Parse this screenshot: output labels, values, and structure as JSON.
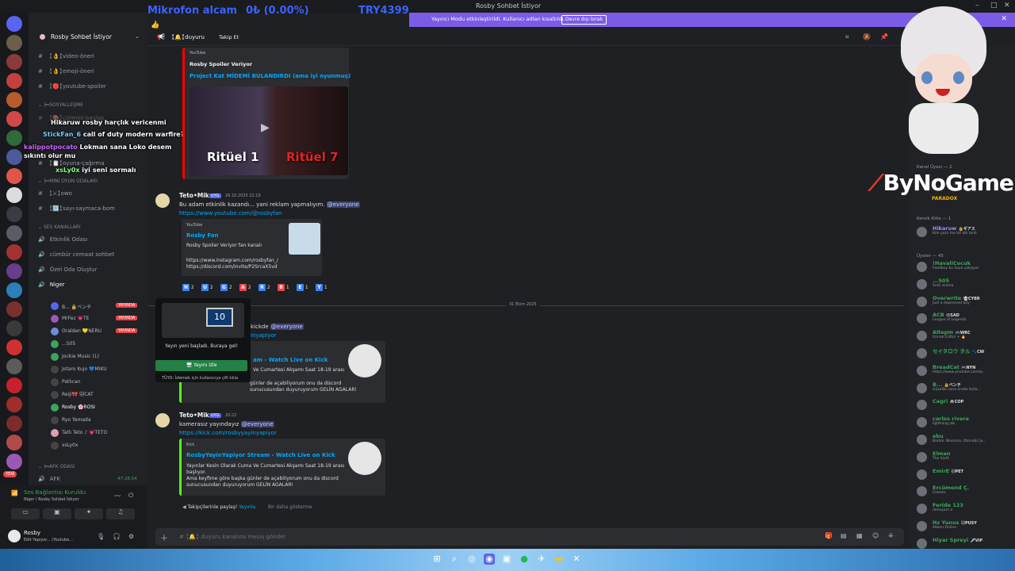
{
  "window": {
    "title": "Rosby Sohbet İstiyor",
    "min": "–",
    "max": "□",
    "close": "✕"
  },
  "banner": {
    "text": "Yayıncı Modu etkinleştirildi. Kullanıcı adları kısaltıldı.",
    "button": "Devre dışı bırak",
    "close": "✕"
  },
  "ticker": {
    "mic": "Mikrofon alcam",
    "amount": "0₺ (0.00%)",
    "goal": "TRY4399",
    "emoji": "👍"
  },
  "sidebar": {
    "server_name": "Rosby Sohbet İstiyor",
    "channels": [
      {
        "name": "╏👌╏video-öneri"
      },
      {
        "name": "╏👌╏emoji-öneri"
      },
      {
        "name": "╏🔴╏youtube-spoiler"
      },
      {
        "name": "SOSYALLEŞME",
        "category": true
      },
      {
        "name": "╏🎨╏çizimini-paylaş"
      },
      {
        "name": "╏📋╏oyuna-çağırma"
      },
      {
        "name": "MİNİ OYUN ODALARI",
        "category": true
      },
      {
        "name": "╏⚔╏owo"
      },
      {
        "name": "╏🔢╏sayı-saymaca-bom"
      },
      {
        "name": "SES KANALLARI",
        "category": true
      },
      {
        "name": "Etkinlik Odası"
      },
      {
        "name": "cümbür cemaat sohbet"
      },
      {
        "name": "Özel Oda Oluştur"
      },
      {
        "name": "Niger"
      }
    ],
    "voice_users": [
      {
        "name": "B... 🔒ベンチ",
        "live": true
      },
      {
        "name": "MrFez 💗TE",
        "live": true
      },
      {
        "name": "Oralden 💛NERU",
        "live": true
      },
      {
        "name": "...505",
        "live": false
      },
      {
        "name": "Jockie Music (1)",
        "live": false
      },
      {
        "name": "Jotaro Kujo 💙MIKU",
        "live": false
      },
      {
        "name": "Patlıcan",
        "live": false
      },
      {
        "name": "Reiji🎀 🐱CAT",
        "live": false
      },
      {
        "name": "Rosby 🌸ROSI",
        "live": false
      },
      {
        "name": "Ryo Yamada",
        "live": false
      },
      {
        "name": "Tatlı Teto ♪ 💗TETO",
        "live": false
      },
      {
        "name": "xsLy0x",
        "live": false
      }
    ],
    "live_label": "YAYINDA",
    "afk_category": "AFK ODASI",
    "afk_channel": "AFK",
    "afk_time": "47:28:54",
    "yeni": "YENİ"
  },
  "chat_overlay": [
    {
      "user": "Hikaruw",
      "text": "rosby harçlık vericenmi"
    },
    {
      "user": "StickFan_6",
      "text": "call of duty modern warfire?"
    },
    {
      "user": "kalippotpocato",
      "text": "Lokman sana Loko desem sıkıntı olur mu"
    },
    {
      "user": "xsLy0x",
      "text": "iyi seni sormalı"
    }
  ],
  "voice_panel": {
    "status": "Ses Bağlantısı Kuruldu",
    "channel": "Niger / Rosby Sohbet İstiyor"
  },
  "user_panel": {
    "name": "Rosby",
    "status": "Edit Yapıyor... (Youtube..."
  },
  "channel_header": {
    "name": "╏🔔╏duyuru",
    "follow": "Takip Et"
  },
  "messages": [
    {
      "embed_provider": "YouTube",
      "embed_author": "Rosby Spoiler Veriyor",
      "embed_title": "Project Kat MİDEMİ BULANDIRDI (ama iyi oyunmuş)",
      "thumb_left": "Ritüel 1",
      "thumb_right": "Ritüel 7"
    },
    {
      "author": "Teto•Miku",
      "badge": "UYG",
      "time": "29.10.2025 22:19",
      "text": "Bu adam etkinlik kazandı... yani reklam yapmalıyım.",
      "mention": "@everyone",
      "link": "https://www.youtube.com/@rosbyfan",
      "embed_provider": "YouTube",
      "embed_title": "Rosby Fan",
      "embed_desc": "Rosby Spoiler Veriyor fan kanalı",
      "embed_links": [
        "https://www.instagram.com/rosbyfan_/",
        "https://discord.com/invite/P2SrcaX5vd"
      ],
      "reactions": [
        {
          "emoji": "N",
          "count": "2",
          "color": "#3b82f6"
        },
        {
          "emoji": "U",
          "count": "2",
          "color": "#3b82f6"
        },
        {
          "emoji": "G",
          "count": "2",
          "color": "#3b82f6"
        },
        {
          "emoji": "A",
          "count": "2",
          "color": "#ef4444"
        },
        {
          "emoji": "R",
          "count": "2",
          "color": "#3b82f6"
        },
        {
          "emoji": "B",
          "count": "1",
          "color": "#ef4444"
        },
        {
          "emoji": "E",
          "count": "1",
          "color": "#3b82f6"
        },
        {
          "emoji": "Y",
          "count": "1",
          "color": "#3b82f6"
        }
      ]
    },
    {
      "date_divider": "31 Ekim 2025",
      "text": "kickde",
      "mention": "@everyone",
      "link": "inyapiyor",
      "embed_title": "am - Watch Live on Kick",
      "embed_desc": [
        "Ve Cumartesi Akşamı Saat 18-19 arası",
        "günler de açabiliyorum onu da discord",
        "sunucusundan duyuruyorum GELİN AGALAR!"
      ]
    },
    {
      "author": "Teto•Miku",
      "badge": "UYG",
      "time": "20:22",
      "text": "kamerasız yayındayız",
      "mention": "@everyone",
      "link": "https://kick.com/rosbyyayinyapiyor",
      "embed_provider": "Kick",
      "embed_title": "RosbyYayinYapiyor Stream - Watch Live on Kick",
      "embed_desc": [
        "Yayınlar Kesin Olarak Cuma Ve Cumartesi Akşamı Saat 18-19 arası",
        "başlıyor.",
        "Ama keyfime göre başka günler de açabiliyorum onu da discord",
        "sunucusundan duyuruyorum GELİN AGALAR!"
      ],
      "share_prefix": "Takipçilerinle paylaş!",
      "share_link": "Yayınla",
      "dismiss": "Bir daha gösterme"
    }
  ],
  "popup": {
    "text": "Yayın yeni başladı. Buraya gel!",
    "button": "Yayını izle",
    "hint": "TÜYO: İzlemek için kullanıcıya çift tıkla",
    "badge": "10"
  },
  "input": {
    "placeholder": "duyuru kanalına mesaj gönder",
    "channel_prefix": "# ╏🔔╏"
  },
  "members": {
    "section1": "Kanal Üyesi — 2",
    "section2": "Kemik Kitle — 1",
    "section3": "Üyeler — 45",
    "list": [
      {
        "name": "Hikaruw",
        "tag": "🔒ギアス",
        "status": "Kim yazıl me laf atlı lardı",
        "color": "#a78bfa"
      },
      {
        "name": "!HavaliCocuk",
        "tag": "",
        "status": "Feedboy bu kaya çalışıyor",
        "color": "#3ba55c"
      },
      {
        "name": "...505",
        "tag": "",
        "status": "Sesli arama",
        "color": "#3ba55c"
      },
      {
        "name": "Overwrite",
        "tag": "👻CYBR",
        "status": "Just a depressed boy",
        "color": "#3ba55c"
      },
      {
        "name": "ACB",
        "tag": "😢SAD",
        "status": "League of Legends",
        "color": "#3ba55c"
      },
      {
        "name": "Altepm",
        "tag": "🎮WRC",
        "status": "Unreal Editor + 🔥",
        "color": "#3ba55c"
      },
      {
        "name": "セイタロウ タル",
        "tag": "🐾CW",
        "status": "",
        "color": "#3ba55c"
      },
      {
        "name": "BreadCat",
        "tag": "🎮NYN",
        "status": "https://www.youtube.com/w...",
        "color": "#3ba55c"
      },
      {
        "name": "B...",
        "tag": "🔒ベンチ",
        "status": "Güzellik sana orada fazla...",
        "color": "#3ba55c"
      },
      {
        "name": "Cagri",
        "tag": "🚔COP",
        "status": "",
        "color": "#3ba55c"
      },
      {
        "name": "carlos rivera",
        "tag": "",
        "status": "lightning jab",
        "color": "#3ba55c"
      },
      {
        "name": "ebu",
        "tag": "",
        "status": "Barkal, Blossom, Otonabil Ju...",
        "color": "#3ba55c"
      },
      {
        "name": "Elman",
        "tag": "",
        "status": "The Sixth",
        "color": "#3ba55c"
      },
      {
        "name": "EmirE",
        "tag": "🐱PET",
        "status": "",
        "color": "#3ba55c"
      },
      {
        "name": "Ercümend Ç.",
        "tag": "",
        "status": "Celeste",
        "color": "#3ba55c"
      },
      {
        "name": "Feride 123",
        "tag": "",
        "status": "donuşum a",
        "color": "#3ba55c"
      },
      {
        "name": "Hz Yunus",
        "tag": "🐱PUSY",
        "status": "Albion Online",
        "color": "#3ba55c"
      },
      {
        "name": "Hiyar Spreyi",
        "tag": "🗡VIP",
        "status": "",
        "color": "#3ba55c"
      }
    ]
  },
  "stream_logo": {
    "text": "ByNoGame",
    "sub": "PARADOX"
  },
  "colors": {
    "accent": "#5865f2",
    "banner": "#7c5ce6",
    "live": "#ed4245",
    "link": "#00a8fc",
    "green": "#3ba55c",
    "kick": "#53fc18",
    "youtube": "#ff0000"
  }
}
